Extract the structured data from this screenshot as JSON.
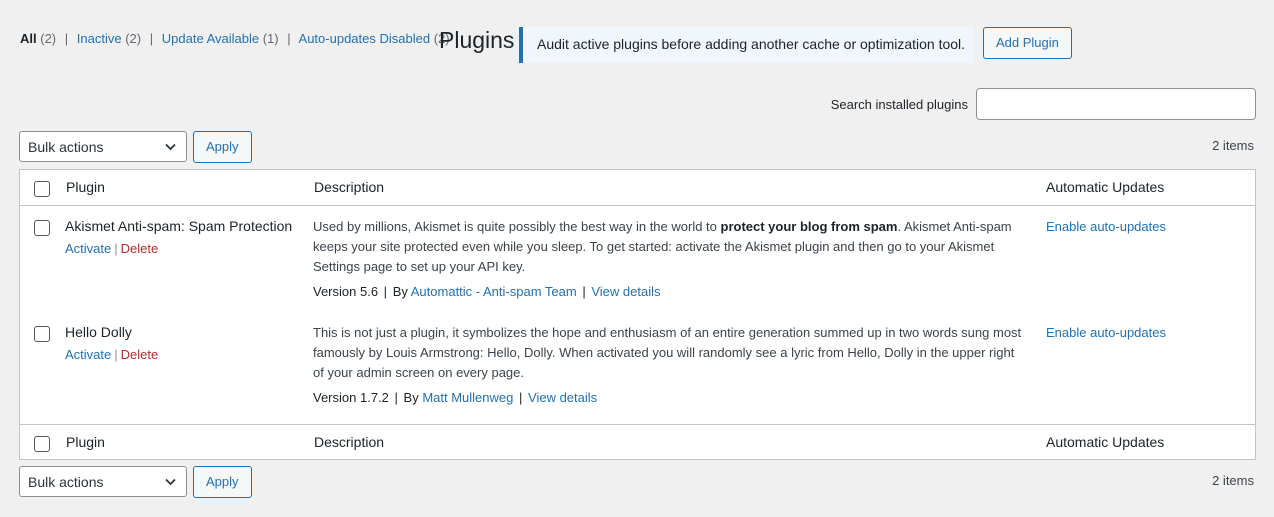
{
  "filters": {
    "all_label": "All",
    "all_count": "(2)",
    "inactive_label": "Inactive",
    "inactive_count": "(2)",
    "update_label": "Update Available",
    "update_count": "(1)",
    "autodisabled_label": "Auto-updates Disabled",
    "autodisabled_count": "(2)",
    "separator": "|"
  },
  "page": {
    "title": "Plugins",
    "notice": "Audit active plugins before adding another cache or optimization tool.",
    "add_button": "Add Plugin"
  },
  "search": {
    "label": "Search installed plugins",
    "value": "",
    "placeholder": ""
  },
  "tablenav": {
    "bulk_selected": "Bulk actions",
    "apply": "Apply",
    "items_count": "2 items"
  },
  "columns": {
    "plugin": "Plugin",
    "description": "Description",
    "auto_updates": "Automatic Updates"
  },
  "plugins": [
    {
      "name": "Akismet Anti-spam: Spam Protection",
      "activate": "Activate",
      "delete": "Delete",
      "desc_pre": "Used by millions, Akismet is quite possibly the best way in the world to ",
      "desc_bold": "protect your blog from spam",
      "desc_post": ". Akismet Anti-spam keeps your site protected even while you sleep. To get started: activate the Akismet plugin and then go to your Akismet Settings page to set up your API key.",
      "version": "Version 5.6",
      "by": "By",
      "author": "Automattic - Anti-spam Team",
      "view_details": "View details",
      "auto_updates_link": "Enable auto-updates"
    },
    {
      "name": "Hello Dolly",
      "activate": "Activate",
      "delete": "Delete",
      "desc_pre": "This is not just a plugin, it symbolizes the hope and enthusiasm of an entire generation summed up in two words sung most famously by Louis Armstrong: Hello, Dolly. When activated you will randomly see a lyric from Hello, Dolly in the upper right of your admin screen on every page.",
      "version": "Version 1.7.2",
      "by": "By",
      "author": "Matt Mullenweg",
      "view_details": "View details",
      "auto_updates_link": "Enable auto-updates"
    }
  ],
  "colors": {
    "background": "#f0f0f1",
    "link": "#2271b1",
    "delete": "#b32d2e",
    "notice_border": "#2271b1",
    "notice_bg": "#f0f6fc"
  }
}
